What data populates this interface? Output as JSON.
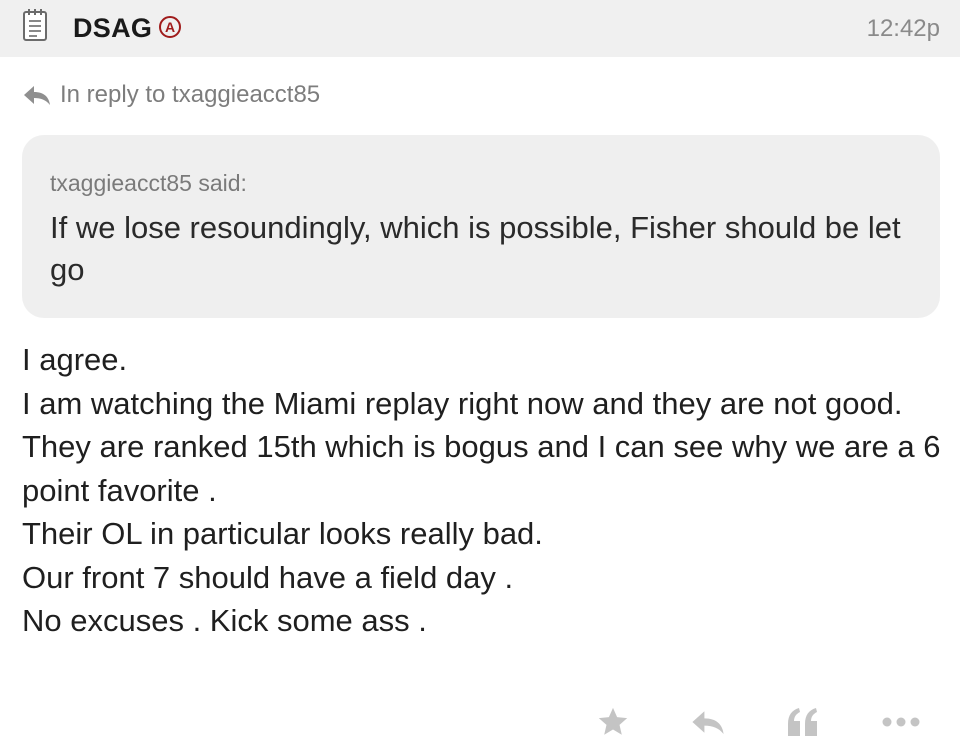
{
  "header": {
    "username": "DSAG",
    "badge": "A",
    "timestamp": "12:42p",
    "icons": {
      "post_icon": "notepad-icon"
    }
  },
  "reply": {
    "icon": "reply-arrow-icon",
    "label": "In reply to txaggieacct85"
  },
  "quote": {
    "author_line": "txaggieacct85 said:",
    "text": "If we lose resoundingly, which is possible, Fisher should be let go"
  },
  "body": {
    "lines": [
      "I agree.",
      "I am watching the Miami replay right now and they are not good.",
      "They are ranked 15th which is bogus and I can see why we are a 6 point favorite .",
      "Their OL in particular looks really bad.",
      "Our front 7 should have a field day .",
      "No excuses . Kick some ass ."
    ]
  },
  "actions": [
    {
      "name": "star-icon"
    },
    {
      "name": "reply-icon"
    },
    {
      "name": "quote-icon"
    },
    {
      "name": "more-icon"
    }
  ],
  "colors": {
    "header_bg": "#f0f0f0",
    "quote_bg": "#efefef",
    "badge": "#a01c1c",
    "muted_text": "#7d7d7d",
    "action_icons": "#c4c4c4"
  }
}
